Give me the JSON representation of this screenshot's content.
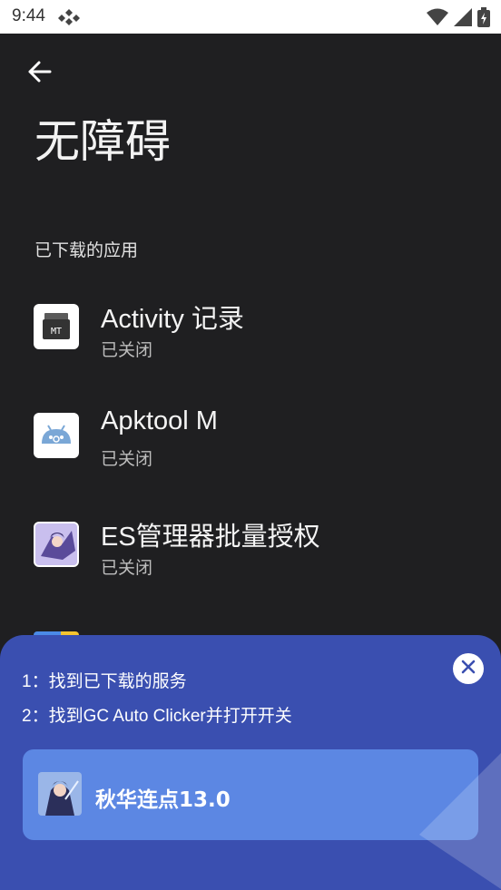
{
  "status_bar": {
    "time": "9:44",
    "icons": [
      "app-notification-icon",
      "wifi-icon",
      "signal-icon",
      "battery-icon"
    ]
  },
  "header": {
    "back_icon": "arrow-left-icon",
    "title": "无障碍"
  },
  "section": {
    "label": "已下载的应用"
  },
  "apps": [
    {
      "name": "Activity 记录",
      "status": "已关闭",
      "icon": "mt-icon"
    },
    {
      "name": "Apktool M",
      "status": "已关闭",
      "icon": "android-icon"
    },
    {
      "name": "ES管理器批量授权",
      "status": "已关闭",
      "icon": "anime-character-icon"
    }
  ],
  "overlay": {
    "step1": "1：找到已下载的服务",
    "step2": "2：找到GC Auto Clicker并打开开关",
    "close_icon": "close-icon",
    "promo_title": "秋华连点13.0",
    "colors": {
      "panel": "#3a4fb0",
      "card": "#5c87e3"
    }
  }
}
